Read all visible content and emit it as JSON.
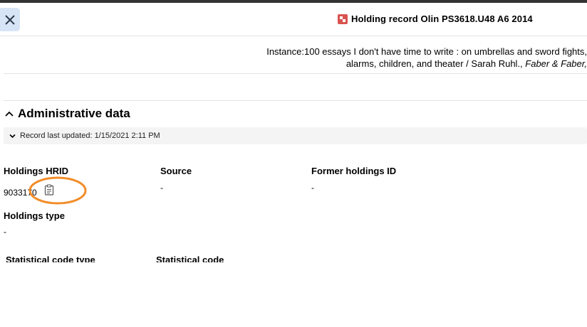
{
  "header": {
    "close_icon": "close-icon",
    "record_icon": "holdings-record-icon",
    "title": "Holding record Olin PS3618.U48 A6 2014"
  },
  "instance": {
    "label": "Instance:",
    "title_line1": "100 essays I don't have time to write : on umbrellas and sword fights,",
    "title_line2": "alarms, children, and theater / Sarah Ruhl., ",
    "publisher": "Faber & Faber,"
  },
  "admin": {
    "section_title": "Administrative data",
    "record_updated": "Record last updated: 1/15/2021 2:11 PM",
    "fields": {
      "holdings_hrid_label": "Holdings HRID",
      "holdings_hrid_value": "9033170",
      "source_label": "Source",
      "source_value": "-",
      "former_id_label": "Former holdings ID",
      "former_id_value": "-",
      "holdings_type_label": "Holdings type",
      "holdings_type_value": "-",
      "stat_code_type_label": "Statistical code type",
      "stat_code_label": "Statistical code"
    },
    "copy_icon": "clipboard-icon"
  },
  "colors": {
    "close_button_bg": "#d6e4f5",
    "highlight": "#f28c28",
    "record_icon": "#d9534f"
  }
}
